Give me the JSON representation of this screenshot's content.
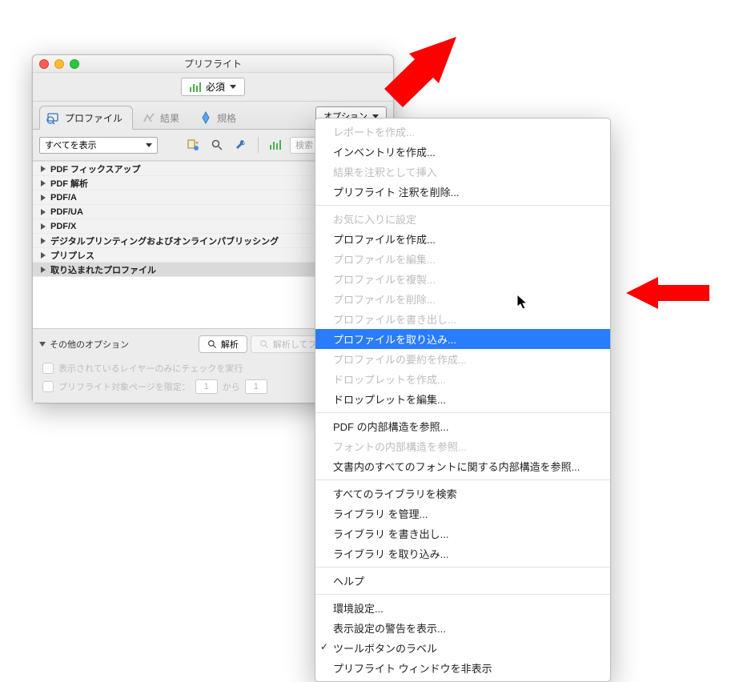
{
  "window": {
    "title": "プリフライト",
    "severity_label": "必須"
  },
  "tabs": {
    "profile": "プロファイル",
    "results": "結果",
    "standards": "規格"
  },
  "options_button": "オプション",
  "filter": {
    "dropdown": "すべてを表示",
    "search_placeholder": "検索"
  },
  "tree": [
    "PDF フィックスアップ",
    "PDF 解析",
    "PDF/A",
    "PDF/UA",
    "PDF/X",
    "デジタルプリンティングおよびオンラインパブリッシング",
    "プリプレス",
    "取り込まれたプロファイル"
  ],
  "bottom": {
    "other_options": "その他のオプション",
    "analyze": "解析",
    "analyze_fix": "解析してフィックスアップ",
    "layer_check": "表示されているレイヤーのみにチェックを実行",
    "page_limit_label": "プリフライト対象ページを限定：",
    "page_from": "1",
    "page_to_label": "から",
    "page_to": "1"
  },
  "menu": {
    "groups": [
      [
        {
          "label": "レポートを作成...",
          "enabled": false
        },
        {
          "label": "インベントリを作成...",
          "enabled": true
        },
        {
          "label": "結果を注釈として挿入",
          "enabled": false
        },
        {
          "label": "プリフライト 注釈を削除...",
          "enabled": true
        }
      ],
      [
        {
          "label": "お気に入りに設定",
          "enabled": false
        },
        {
          "label": "プロファイルを作成...",
          "enabled": true
        },
        {
          "label": "プロファイルを編集...",
          "enabled": false
        },
        {
          "label": "プロファイルを複製...",
          "enabled": false
        },
        {
          "label": "プロファイルを削除...",
          "enabled": false
        },
        {
          "label": "プロファイルを書き出し...",
          "enabled": false
        },
        {
          "label": "プロファイルを取り込み...",
          "enabled": true,
          "selected": true
        },
        {
          "label": "プロファイルの要約を作成...",
          "enabled": false
        },
        {
          "label": "ドロップレットを作成...",
          "enabled": false
        },
        {
          "label": "ドロップレットを編集...",
          "enabled": true
        }
      ],
      [
        {
          "label": "PDF の内部構造を参照...",
          "enabled": true
        },
        {
          "label": "フォントの内部構造を参照...",
          "enabled": false
        },
        {
          "label": "文書内のすべてのフォントに関する内部構造を参照...",
          "enabled": true
        }
      ],
      [
        {
          "label": "すべてのライブラリを検索",
          "enabled": true
        },
        {
          "label": "ライブラリ を管理...",
          "enabled": true
        },
        {
          "label": "ライブラリ を書き出し...",
          "enabled": true
        },
        {
          "label": "ライブラリ を取り込み...",
          "enabled": true
        }
      ],
      [
        {
          "label": "ヘルプ",
          "enabled": true
        }
      ],
      [
        {
          "label": "環境設定...",
          "enabled": true
        },
        {
          "label": "表示設定の警告を表示...",
          "enabled": true
        },
        {
          "label": "ツールボタンのラベル",
          "enabled": true,
          "checked": true
        },
        {
          "label": "プリフライト ウィンドウを非表示",
          "enabled": true
        }
      ]
    ]
  }
}
